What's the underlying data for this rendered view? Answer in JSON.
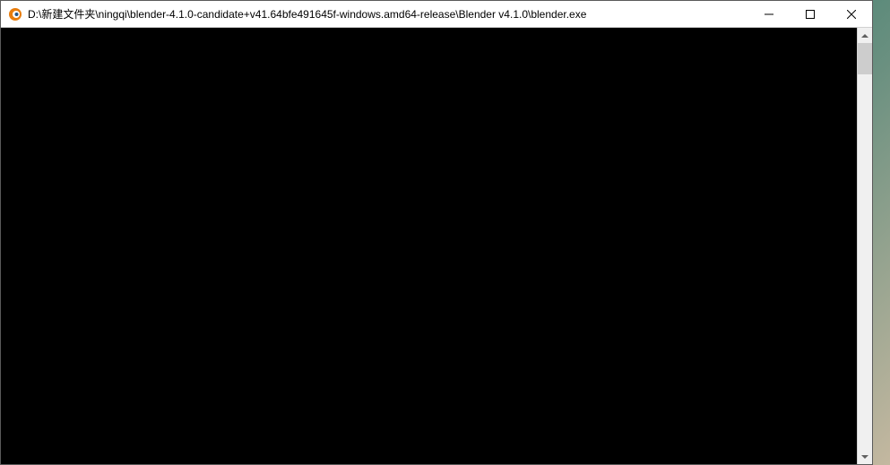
{
  "window": {
    "title": "D:\\新建文件夹\\ningqi\\blender-4.1.0-candidate+v41.64bfe491645f-windows.amd64-release\\Blender v4.1.0\\blender.exe",
    "icon": "blender-icon",
    "controls": {
      "minimize": "minimize-icon",
      "maximize": "maximize-icon",
      "close": "close-icon"
    }
  },
  "console": {
    "content": ""
  }
}
